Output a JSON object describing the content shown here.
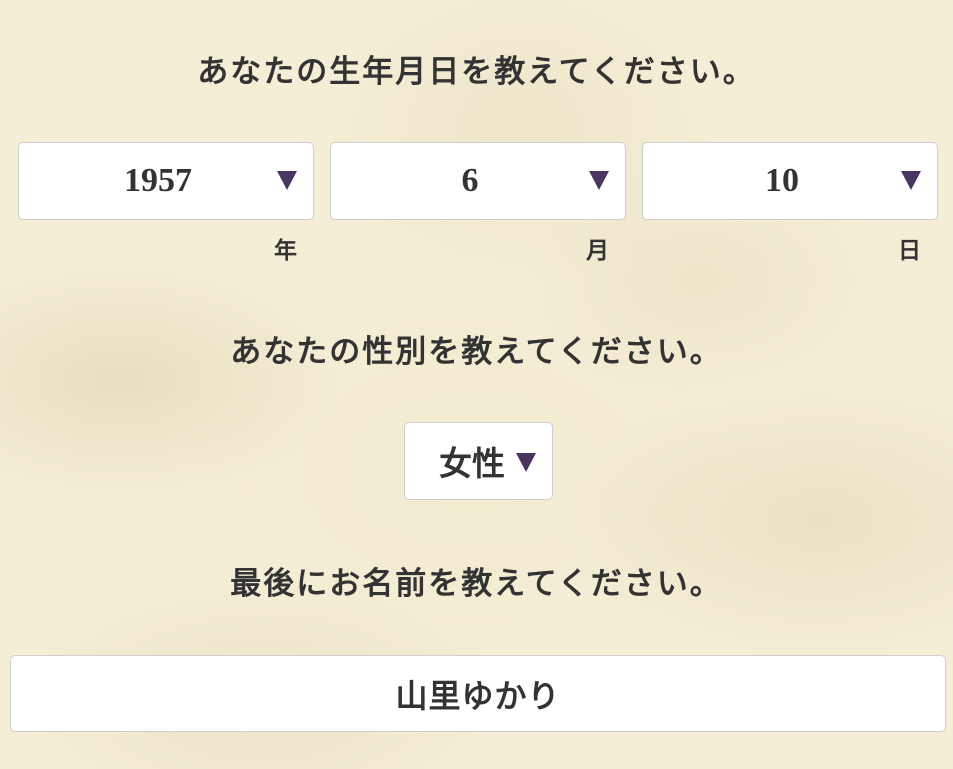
{
  "birthdate": {
    "heading": "あなたの生年月日を教えてください。",
    "year": {
      "value": "1957",
      "unit": "年"
    },
    "month": {
      "value": "6",
      "unit": "月"
    },
    "day": {
      "value": "10",
      "unit": "日"
    }
  },
  "gender": {
    "heading": "あなたの性別を教えてください。",
    "value": "女性"
  },
  "name": {
    "heading": "最後にお名前を教えてください。",
    "value": "山里ゆかり"
  },
  "colors": {
    "background": "#f4eed6",
    "arrow": "#4a3560",
    "field": "#ffffff",
    "text": "#333333"
  },
  "icons": [
    "dropdown-arrow-icon"
  ]
}
